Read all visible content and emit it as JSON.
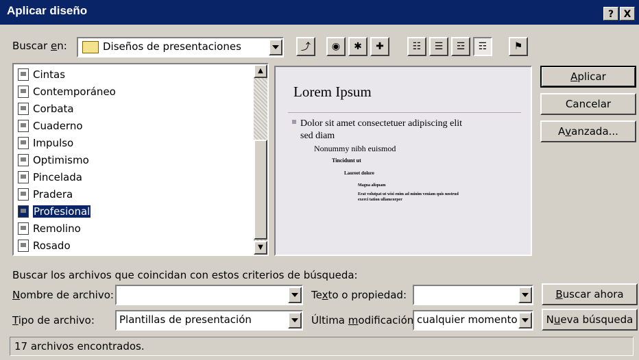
{
  "window": {
    "title": "Aplicar diseño",
    "help_label": "?",
    "close_label": "X"
  },
  "lookin": {
    "label_prefix": "Buscar ",
    "label_u": "e",
    "label_rest": "n:",
    "value": "Diseños de presentaciones"
  },
  "toolbar": {
    "tools": [
      "up-folder-icon",
      "web-search-icon",
      "favorites-icon",
      "add-favorites-icon",
      "list-view-icon",
      "details-view-icon",
      "properties-view-icon",
      "preview-view-icon",
      "commands-icon"
    ]
  },
  "files": [
    {
      "name": "Cintas"
    },
    {
      "name": "Contemporáneo"
    },
    {
      "name": "Corbata"
    },
    {
      "name": "Cuaderno"
    },
    {
      "name": "Impulso"
    },
    {
      "name": "Optimismo"
    },
    {
      "name": "Pincelada"
    },
    {
      "name": "Pradera"
    },
    {
      "name": "Profesional",
      "selected": true
    },
    {
      "name": "Remolino"
    },
    {
      "name": "Rosado"
    }
  ],
  "preview": {
    "title": "Lorem Ipsum",
    "line1": "Dolor sit amet consectetuer adipiscing elit",
    "line1b": "sed diam",
    "line2": "Nonummy nibh euismod",
    "line3": "Tincidunt ut",
    "line4": "Laoreet dolore",
    "line5": "Magna aliquam",
    "line6": "Erat volutpat ut wisi enim ad minim veniam quis nostrud",
    "line6b": "exerci tation ullamcorper"
  },
  "buttons": {
    "apply_u": "A",
    "apply_rest": "plicar",
    "cancel": "Cancelar",
    "advanced_pre": "A",
    "advanced_u": "v",
    "advanced_rest": "anzada...",
    "search_u": "B",
    "search_rest": "uscar ahora",
    "new_pre": "N",
    "new_u": "u",
    "new_rest": "eva búsqueda"
  },
  "criteria": {
    "heading": "Buscar los archivos que coincidan con estos criterios de búsqueda:"
  },
  "filename": {
    "label_u": "N",
    "label_rest": "ombre de archivo:",
    "value": ""
  },
  "filetype": {
    "label_u": "T",
    "label_rest": "ipo de archivo:",
    "value": "Plantillas de presentación"
  },
  "textprop": {
    "label_pre": "Te",
    "label_u": "x",
    "label_rest": "to o propiedad:",
    "value": ""
  },
  "lastmod": {
    "label_pre": "Última ",
    "label_u": "m",
    "label_rest": "odificación:",
    "value": "cualquier momento"
  },
  "status": {
    "text": "17 archivos encontrados."
  }
}
